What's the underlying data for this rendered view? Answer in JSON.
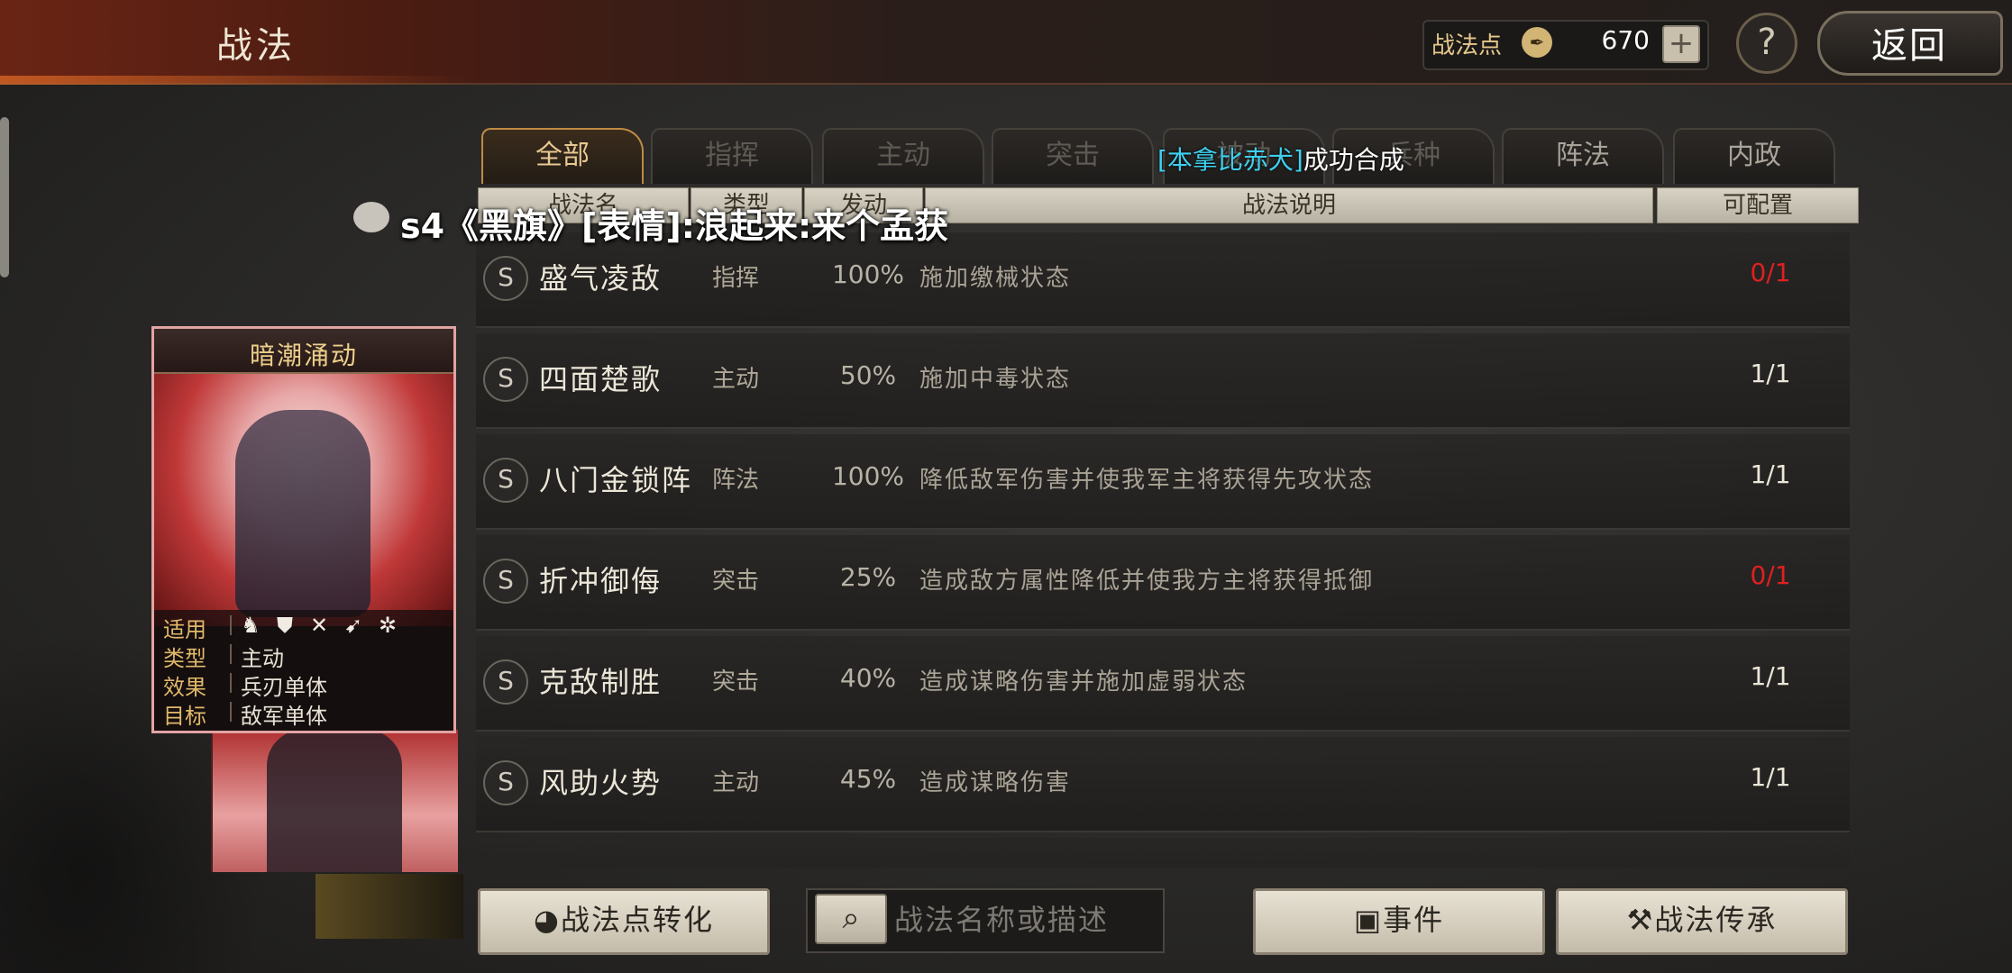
{
  "header": {
    "title": "战法",
    "points_label": "战法点",
    "points_icon": "quill-icon",
    "points_value": "670",
    "add_label": "+",
    "help_label": "?",
    "back_label": "返回"
  },
  "tabs": [
    {
      "label": "全部",
      "active": true
    },
    {
      "label": "指挥",
      "active": false
    },
    {
      "label": "主动",
      "active": false
    },
    {
      "label": "突击",
      "active": false
    },
    {
      "label": "被动",
      "active": false
    },
    {
      "label": "兵种",
      "active": false
    },
    {
      "label": "阵法",
      "active": false
    },
    {
      "label": "内政",
      "active": false
    }
  ],
  "columns": {
    "name": "战法名",
    "type": "类型",
    "rate": "发动",
    "desc": "战法说明",
    "config": "可配置"
  },
  "overlay": {
    "chat": "s4《黑旗》[表情]:浪起来:来个孟获",
    "cyan": "[本拿比赤犬]",
    "white": "成功合成"
  },
  "rows": [
    {
      "badge": "S",
      "name": "盛气凌敌",
      "type": "指挥",
      "rate": "100%",
      "desc": "施加缴械状态",
      "config": "0/1",
      "config_color": "#e02020"
    },
    {
      "badge": "S",
      "name": "四面楚歌",
      "type": "主动",
      "rate": "50%",
      "desc": "施加中毒状态",
      "config": "1/1",
      "config_color": "#ece6d8"
    },
    {
      "badge": "S",
      "name": "八门金锁阵",
      "type": "阵法",
      "rate": "100%",
      "desc": "降低敌军伤害并使我军主将获得先攻状态",
      "config": "1/1",
      "config_color": "#ece6d8"
    },
    {
      "badge": "S",
      "name": "折冲御侮",
      "type": "突击",
      "rate": "25%",
      "desc": "造成敌方属性降低并使我方主将获得抵御",
      "config": "0/1",
      "config_color": "#e02020"
    },
    {
      "badge": "S",
      "name": "克敌制胜",
      "type": "突击",
      "rate": "40%",
      "desc": "造成谋略伤害并施加虚弱状态",
      "config": "1/1",
      "config_color": "#ece6d8"
    },
    {
      "badge": "S",
      "name": "风助火势",
      "type": "主动",
      "rate": "45%",
      "desc": "造成谋略伤害",
      "config": "1/1",
      "config_color": "#ece6d8"
    }
  ],
  "card": {
    "title": "暗潮涌动",
    "applicable_label": "适用",
    "unit_icons": [
      "cavalry-icon",
      "shield-icon",
      "bow-icon",
      "spear-icon",
      "wheel-icon"
    ],
    "type_label": "类型",
    "type_value": "主动",
    "effect_label": "效果",
    "effect_value": "兵刃单体",
    "target_label": "目标",
    "target_value": "敌军单体"
  },
  "bottom": {
    "convert_label": "战法点转化",
    "search_placeholder": "战法名称或描述",
    "event_label": "事件",
    "inherit_label": "战法传承"
  }
}
